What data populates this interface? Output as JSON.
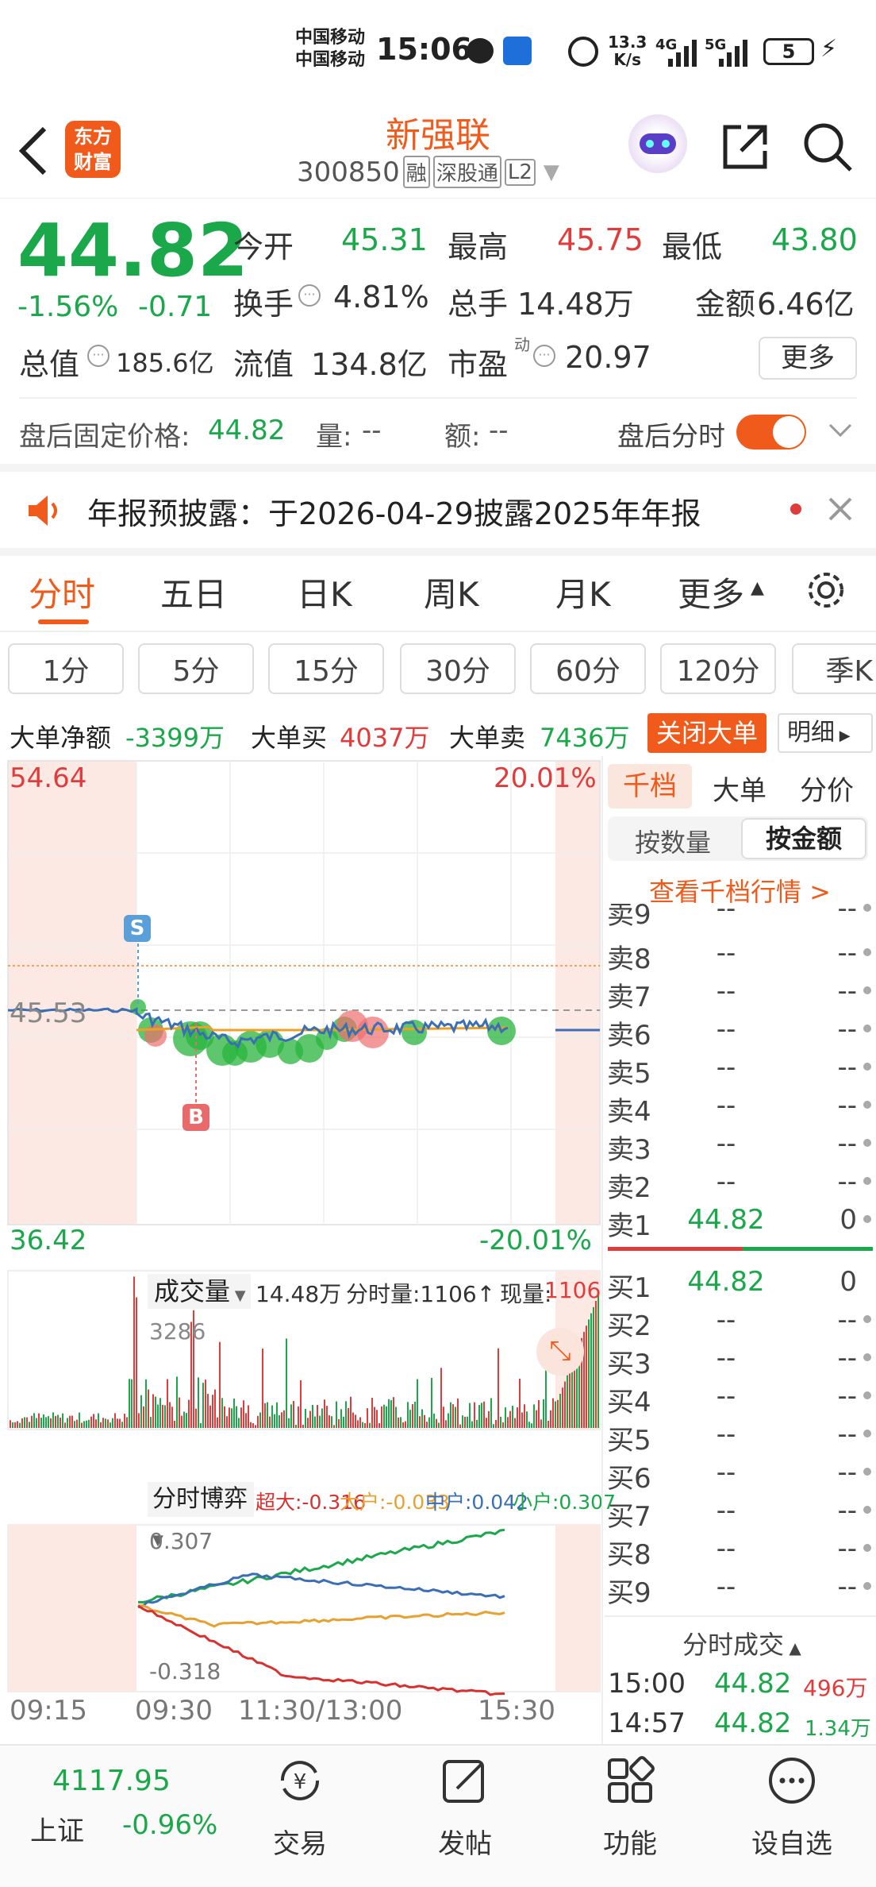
{
  "status_bar": {
    "carrier1": "中国移动",
    "carrier2": "中国移动",
    "time": "15:06",
    "net_speed_value": "13.3",
    "net_speed_unit": "K/s",
    "net1": "4G",
    "net2": "5G",
    "battery": "5"
  },
  "header": {
    "logo_line1": "东方",
    "logo_line2": "财富",
    "stock_name": "新强联",
    "stock_code": "300850",
    "badges": [
      "融",
      "深股通",
      "L2"
    ]
  },
  "quote": {
    "price": "44.82",
    "change_pct": "-1.56%",
    "change": "-0.71",
    "fields": [
      {
        "label": "今开",
        "value": "45.31"
      },
      {
        "label": "最高",
        "value": "45.75"
      },
      {
        "label": "最低",
        "value": "43.80"
      },
      {
        "label": "换手",
        "value": "4.81%"
      },
      {
        "label": "总手",
        "value": "14.48万"
      },
      {
        "label": "金额",
        "value": "6.46亿"
      },
      {
        "label": "总值",
        "value": "185.6亿"
      },
      {
        "label": "流值",
        "value": "134.8亿"
      },
      {
        "label": "市盈",
        "value": "20.97"
      }
    ],
    "pe_superscript": "动",
    "more_button": "更多"
  },
  "after_hours": {
    "label": "盘后固定价格:",
    "price": "44.82",
    "vol_label": "量:",
    "vol_value": "--",
    "amt_label": "额:",
    "amt_value": "--",
    "toggle_label": "盘后分时",
    "toggle_on": true
  },
  "notice": {
    "text": "年报预披露：于2026-04-29披露2025年年报"
  },
  "chart_tabs": [
    "分时",
    "五日",
    "日K",
    "周K",
    "月K",
    "更多"
  ],
  "active_chart_tab": "分时",
  "periods": [
    "1分",
    "5分",
    "15分",
    "30分",
    "60分",
    "120分",
    "季K"
  ],
  "big_orders": {
    "net_label": "大单净额",
    "net_value": "-3399万",
    "buy_label": "大单买",
    "buy_value": "4037万",
    "sell_label": "大单卖",
    "sell_value": "7436万",
    "close_button": "关闭大单",
    "detail_button": "明细"
  },
  "intraday": {
    "top_price": "54.64",
    "bottom_price": "36.42",
    "top_pct": "20.01%",
    "bottom_pct": "-20.01%",
    "ref_price": "45.53",
    "marker_s": "S",
    "marker_b": "B"
  },
  "volume_panel": {
    "selector": "成交量",
    "total": "14.48万",
    "minute_label": "分时量:1106↑",
    "current_label": "现量:",
    "current_value": "1106",
    "max_label": "3286"
  },
  "game_panel": {
    "selector": "分时博弈",
    "super_label": "超大:-0.316",
    "large_label": "大户:-0.033",
    "mid_label": "中户:0.042",
    "small_label": "小户:0.307",
    "max_label": "0.307",
    "min_label": "-0.318"
  },
  "time_axis": [
    "09:15",
    "09:30",
    "11:30/13:00",
    "15:30"
  ],
  "order_book": {
    "tabs": [
      "千档",
      "大单",
      "分价"
    ],
    "active_tab": "千档",
    "sub_tabs": [
      "按数量",
      "按金额"
    ],
    "active_sub_tab": "按金额",
    "link": "查看千档行情 >",
    "asks": [
      {
        "label": "卖9",
        "price": "--",
        "vol": "--"
      },
      {
        "label": "卖8",
        "price": "--",
        "vol": "--"
      },
      {
        "label": "卖7",
        "price": "--",
        "vol": "--"
      },
      {
        "label": "卖6",
        "price": "--",
        "vol": "--"
      },
      {
        "label": "卖5",
        "price": "--",
        "vol": "--"
      },
      {
        "label": "卖4",
        "price": "--",
        "vol": "--"
      },
      {
        "label": "卖3",
        "price": "--",
        "vol": "--"
      },
      {
        "label": "卖2",
        "price": "--",
        "vol": "--"
      },
      {
        "label": "卖1",
        "price": "44.82",
        "vol": "0"
      }
    ],
    "bids": [
      {
        "label": "买1",
        "price": "44.82",
        "vol": "0"
      },
      {
        "label": "买2",
        "price": "--",
        "vol": "--"
      },
      {
        "label": "买3",
        "price": "--",
        "vol": "--"
      },
      {
        "label": "买4",
        "price": "--",
        "vol": "--"
      },
      {
        "label": "买5",
        "price": "--",
        "vol": "--"
      },
      {
        "label": "买6",
        "price": "--",
        "vol": "--"
      },
      {
        "label": "买7",
        "price": "--",
        "vol": "--"
      },
      {
        "label": "买8",
        "price": "--",
        "vol": "--"
      },
      {
        "label": "买9",
        "price": "--",
        "vol": "--"
      }
    ],
    "trades_title": "分时成交",
    "trades": [
      {
        "time": "15:00",
        "price": "44.82",
        "vol": "496万"
      },
      {
        "time": "14:57",
        "price": "44.82",
        "vol": "1.34万"
      }
    ]
  },
  "bottom_nav": {
    "index_value": "4117.95",
    "index_name": "上证",
    "index_change": "-0.96%",
    "items": [
      {
        "label": "交易",
        "icon": "yuan-exchange-icon"
      },
      {
        "label": "发帖",
        "icon": "edit-post-icon"
      },
      {
        "label": "功能",
        "icon": "grid-icon"
      },
      {
        "label": "设自选",
        "icon": "more-dots-icon"
      }
    ]
  },
  "colors": {
    "up": "#e03c3c",
    "down": "#1aa84a",
    "accent": "#f05a1a",
    "price_line": "#3a6fb5"
  }
}
